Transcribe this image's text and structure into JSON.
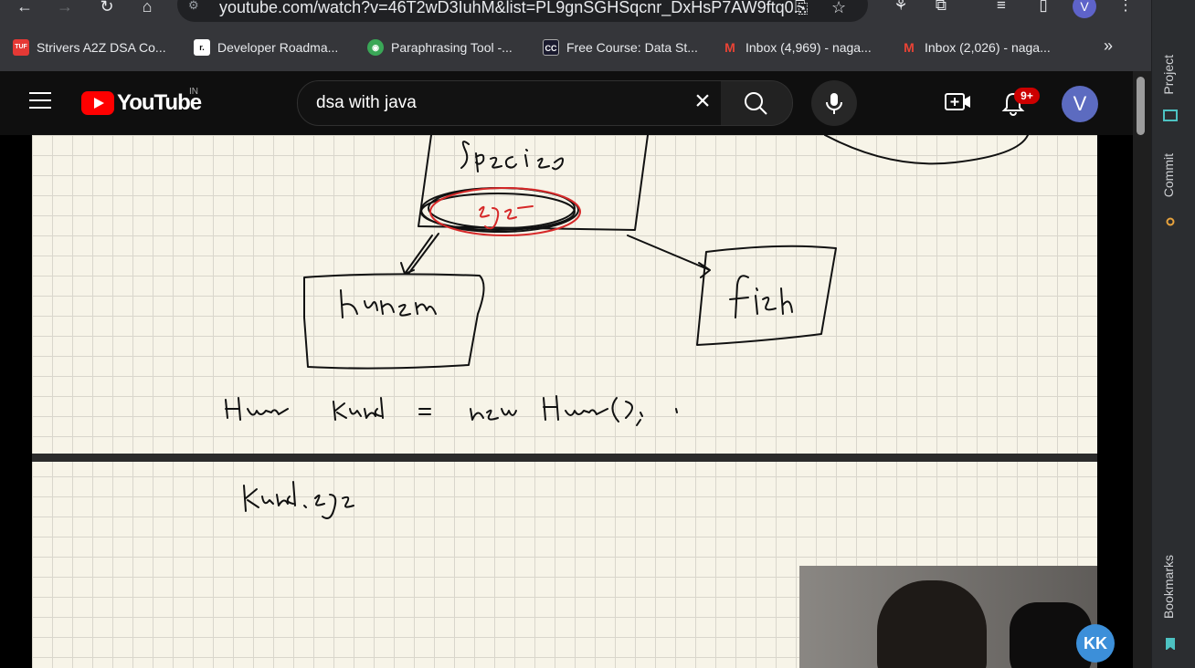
{
  "browser": {
    "url": "youtube.com/watch?v=46T2wD3IuhM&list=PL9gnSGHSqcnr_DxHsP7AW9ftq0...",
    "profile_initial": "V",
    "bookmarks": [
      {
        "label": "Strivers A2Z DSA Co...",
        "fav": "TUF",
        "color": "#e53935"
      },
      {
        "label": "Developer Roadma...",
        "fav": "r.",
        "color": "#000000"
      },
      {
        "label": "Paraphrasing Tool -...",
        "fav": "◉",
        "color": "#3aa757"
      },
      {
        "label": "Free Course: Data St...",
        "fav": "CC",
        "color": "#1a1a2e"
      },
      {
        "label": "Inbox (4,969) - naga...",
        "fav": "M",
        "color": "#ea4335"
      },
      {
        "label": "Inbox (2,026) - naga...",
        "fav": "M",
        "color": "#ea4335"
      }
    ],
    "bookmarks_more": "»"
  },
  "youtube": {
    "logo_text": "YouTube",
    "country_code": "IN",
    "search_value": "dsa with java",
    "notification_count": "9+",
    "avatar_initial": "V"
  },
  "ide_panel": {
    "tabs": [
      "Project",
      "Commit",
      "Bookmarks"
    ]
  },
  "colors": {
    "youtube_red": "#ff0000",
    "board_bg": "#f7f4e8",
    "ink": "#111111",
    "red_ink": "#d62828"
  }
}
